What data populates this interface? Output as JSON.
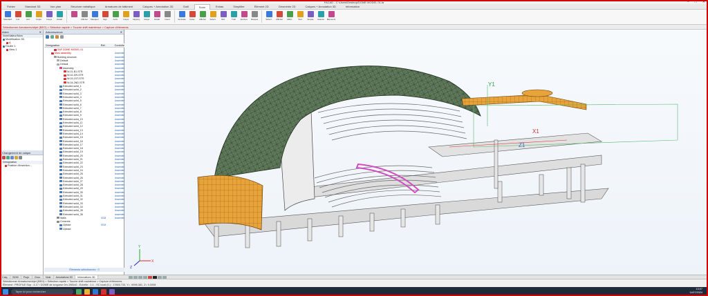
{
  "window": {
    "title": "FACAD - C:\\Users\\Desktop\\DOME MODEL 01.fa",
    "controls": [
      "–",
      "□",
      "✕"
    ]
  },
  "menu": {
    "tabs": [
      "Fichier",
      "Standard 3D",
      "Vue plan",
      "Structure métallique",
      "Armatures de bâtiment",
      "Calques + Annotation 2D",
      "Outil",
      "Scan",
      "Extras",
      "Simplifier",
      "Élément 2D",
      "Géométrie 2D",
      "Calques + Annotation 3D",
      "Information"
    ],
    "active_index": 7
  },
  "ribbon": {
    "buttons": [
      "Standard",
      "4 Ar.",
      "Acc.",
      "Copie",
      "Coupe",
      "Détail",
      "",
      "Afficher",
      "Masquer",
      "Sign",
      "Activ.",
      "Coupe",
      "Clipping",
      "Coupe",
      "Détail",
      "Insert",
      "Verticale",
      "Isoler",
      "Afficher",
      "Sélect.",
      "Réf.",
      "Trait",
      "Exclure",
      "Masque",
      "Sélect.",
      "Afficher",
      "Affich.",
      "Tout",
      "Simple",
      "Avancé",
      "Éléments"
    ]
  },
  "docbar": {
    "path": "Sélectionner Armatures/objet (BEO) > Sélection rapide > Touche shift maintenue > Capture d'éléments"
  },
  "left_panel": {
    "header": "Arbre",
    "col_header": "Nom/Valeur/Nom",
    "rows": [
      "Modélisation 3D",
      "A",
      "Feuille 1",
      "View 1"
    ],
    "lower_header": "Changement de calque",
    "lower_col": "Désignation",
    "lower_rows": [
      "Position d'insertion..."
    ]
  },
  "tree_panel": {
    "header": "Arborescence",
    "col_name": "Désignation",
    "col_ref": "Réf.",
    "col_ctrl": "Contrôle",
    "root": "SAF DOME MODEL 01",
    "main_assembly": "Main assembly",
    "building_structure": "Building structure",
    "default1": "Default",
    "default2": "Default",
    "assembly": "Assembly",
    "sub_assemblies": [
      "W-01-B1-STR",
      "W-02-GR-STR",
      "W-03-1ST-STR",
      "W-04-2ND-STR"
    ],
    "extruded_solids": [
      "Extruded solid_1",
      "Extruded solid_2",
      "Extruded solid_3",
      "Extruded solid_4",
      "Extruded solid_5",
      "Extruded solid_6",
      "Extruded solid_7",
      "Extruded solid_8",
      "Extruded solid_9",
      "Extruded solid_10",
      "Extruded solid_11",
      "Extruded solid_12",
      "Extruded solid_13",
      "Extruded solid_14",
      "Extruded solid_15",
      "Extruded solid_16",
      "Extruded solid_17",
      "Extruded solid_18",
      "Extruded solid_19",
      "Extruded solid_20",
      "Extruded solid_21",
      "Extruded solid_22",
      "Extruded solid_23",
      "Extruded solid_24",
      "Extruded solid_25",
      "Extruded solid_26",
      "Extruded solid_27",
      "Extruded solid_28",
      "Extruded solid_29",
      "Extruded solid_30",
      "Extruded solid_31",
      "Extruded solid_32",
      "Extruded solid_33",
      "Extruded solid_34",
      "Extruded solid_35",
      "Extruded solid_36"
    ],
    "walls": "Walls",
    "concrete": "Concrete",
    "upload1": "Upload",
    "upload2": "Upload",
    "status_value": "Assemblé",
    "count": "0218",
    "footer": "Éléments sélectionnés : 0"
  },
  "viewport": {
    "axis_labels": [
      "Y1",
      "X1",
      "Z1"
    ],
    "triad": [
      "X",
      "Y",
      "Z"
    ]
  },
  "bottom_tabs": [
    "Calq.",
    "BOM",
    "Proje.",
    "Grou.",
    "Note",
    "Annotations 3D",
    "Informations 3D"
  ],
  "status": {
    "line1": "Sélectionner Armatures/objet (BEO) > Sélection rapide > Touche shift maintenue > Capture d'éléments",
    "line2": "Élément : PROFILE Sup : 4.17 / DOME de longueur 0m-1981x0 - Echelle : 1:1 - SC local (0.) : 17865.733, Y= -9998.381, Z= 0.0008"
  },
  "taskbar": {
    "search_placeholder": "Taper ici pour rechercher",
    "time": "13:07",
    "date": "11/07/2024"
  },
  "colors": {
    "frame": "#d40000",
    "dome": "#5f7a5a",
    "facade_orange": "#e8a33a",
    "selection_magenta": "#d14dc0"
  }
}
